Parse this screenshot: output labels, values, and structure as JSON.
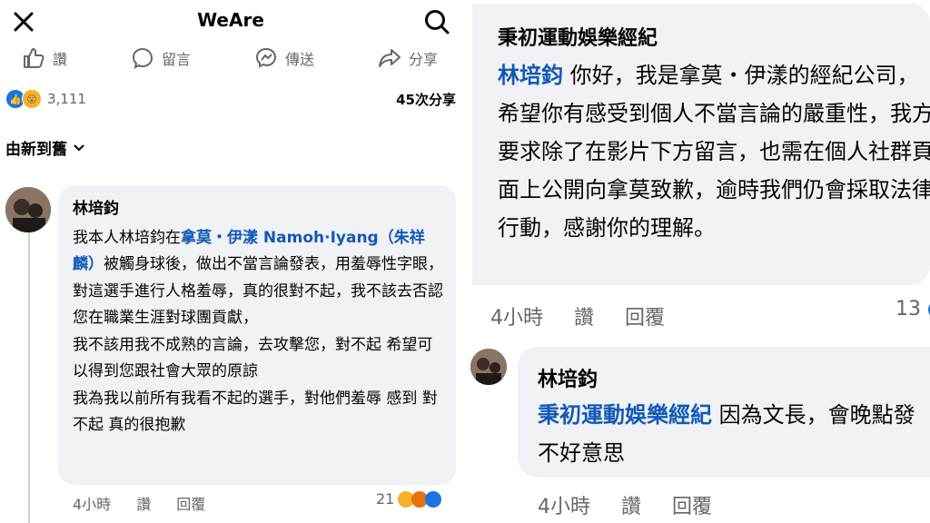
{
  "app": {
    "title": "WeAre"
  },
  "actions": {
    "like": "讚",
    "comment": "留言",
    "send": "傳送",
    "share": "分享"
  },
  "reactions": {
    "count": "3,111",
    "shares": "45次分享"
  },
  "sort": {
    "label": "由新到舊"
  },
  "left_comment": {
    "author": "林培鈞",
    "line1_pre": "我本人林培鈞在",
    "mention": "拿莫・伊漾 Namoh·Iyang（朱祥麟）",
    "line1_post": "被觸身球後，做出不當言論發表，用羞辱性字眼，對這選手進行人格羞辱，真的很對不起，我不該去否認您在職業生涯對球團貢獻，",
    "para2": "我不該用我不成熟的言論，去攻擊您，對不起 希望可以得到您跟社會大眾的原諒",
    "para3": "我為我以前所有我看不起的選手，對他們羞辱 感到 對不起 真的很抱歉",
    "time": "4小時",
    "like": "讚",
    "reply": "回覆",
    "reaction_count": "21"
  },
  "right_comment1": {
    "author": "秉初運動娛樂經紀",
    "mention": "林培鈞",
    "text": " 你好，我是拿莫・伊漾的經紀公司，希望你有感受到個人不當言論的嚴重性，我方要求除了在影片下方留言，也需在個人社群頁面上公開向拿莫致歉，逾時我們仍會採取法律行動，感謝你的理解。",
    "time": "4小時",
    "like": "讚",
    "reply": "回覆",
    "reaction_count": "13"
  },
  "right_comment2": {
    "author": "林培鈞",
    "mention": "秉初運動娛樂經紀",
    "text": " 因為文長，會晚點發 不好意思",
    "time": "4小時",
    "like": "讚",
    "reply": "回覆"
  },
  "colors": {
    "mention": "#1159b8",
    "bubble": "#f0f2f5",
    "meta": "#65676b",
    "like_blue": "#1b74e4"
  }
}
